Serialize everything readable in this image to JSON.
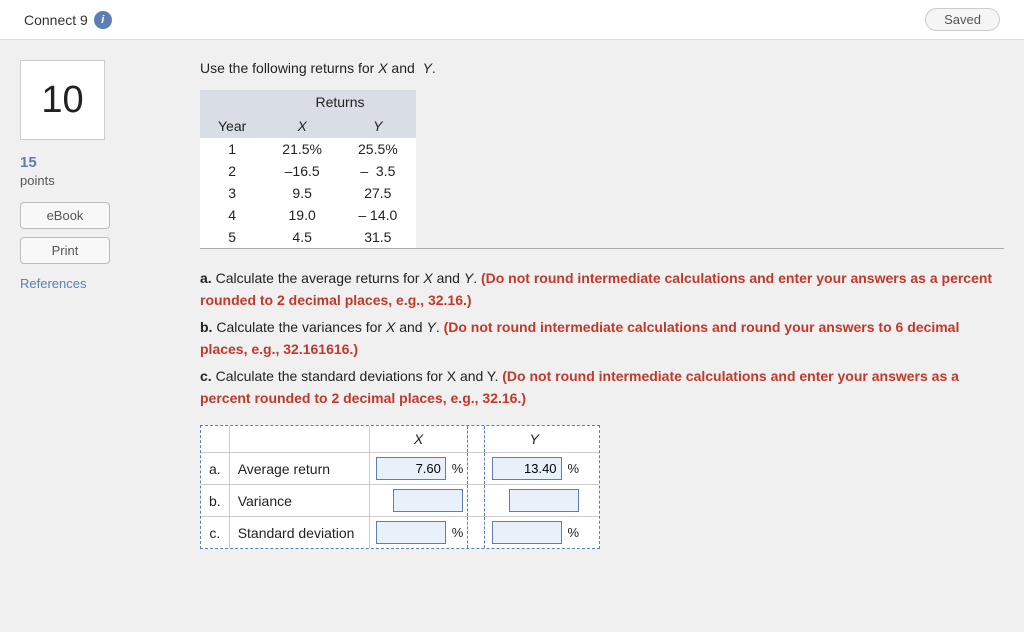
{
  "topbar": {
    "title": "Connect 9",
    "saved_label": "Saved"
  },
  "question": {
    "number": "10",
    "points_value": "15",
    "points_label": "points",
    "intro": "Use the following returns for X and  Y.",
    "returns_table": {
      "header_group": "Returns",
      "columns": [
        "Year",
        "X",
        "Y"
      ],
      "rows": [
        {
          "year": "1",
          "x": "21.5%",
          "y": "25.5%"
        },
        {
          "year": "2",
          "x": "–16.5",
          "y": "–  3.5"
        },
        {
          "year": "3",
          "x": "9.5",
          "y": "27.5"
        },
        {
          "year": "4",
          "x": "19.0",
          "y": "– 14.0"
        },
        {
          "year": "5",
          "x": "4.5",
          "y": "31.5"
        }
      ]
    },
    "instructions": [
      {
        "label": "a.",
        "text": "Calculate the average returns for X and Y.",
        "bold": "(Do not round intermediate calculations and enter your answers as a percent rounded to 2 decimal places, e.g., 32.16.)"
      },
      {
        "label": "b.",
        "text": "Calculate the variances for X and Y.",
        "bold": "(Do not round intermediate calculations and round your answers to 6 decimal places, e.g., 32.161616.)"
      },
      {
        "label": "c.",
        "text": "Calculate the standard deviations for X and Y.",
        "bold": "(Do not round intermediate calculations and enter your answers as a percent rounded to 2 decimal places, e.g., 32.16.)"
      }
    ],
    "answer_table": {
      "col_x_header": "X",
      "col_y_header": "Y",
      "rows": [
        {
          "label": "a.",
          "name": "Average return",
          "x_value": "7.60",
          "x_suffix": "%",
          "y_value": "13.40",
          "y_suffix": "%"
        },
        {
          "label": "b.",
          "name": "Variance",
          "x_value": "",
          "x_suffix": "",
          "y_value": "",
          "y_suffix": ""
        },
        {
          "label": "c.",
          "name": "Standard deviation",
          "x_value": "",
          "x_suffix": "%",
          "y_value": "",
          "y_suffix": "%"
        }
      ]
    }
  },
  "sidebar": {
    "ebook_label": "eBook",
    "print_label": "Print",
    "references_label": "References"
  }
}
